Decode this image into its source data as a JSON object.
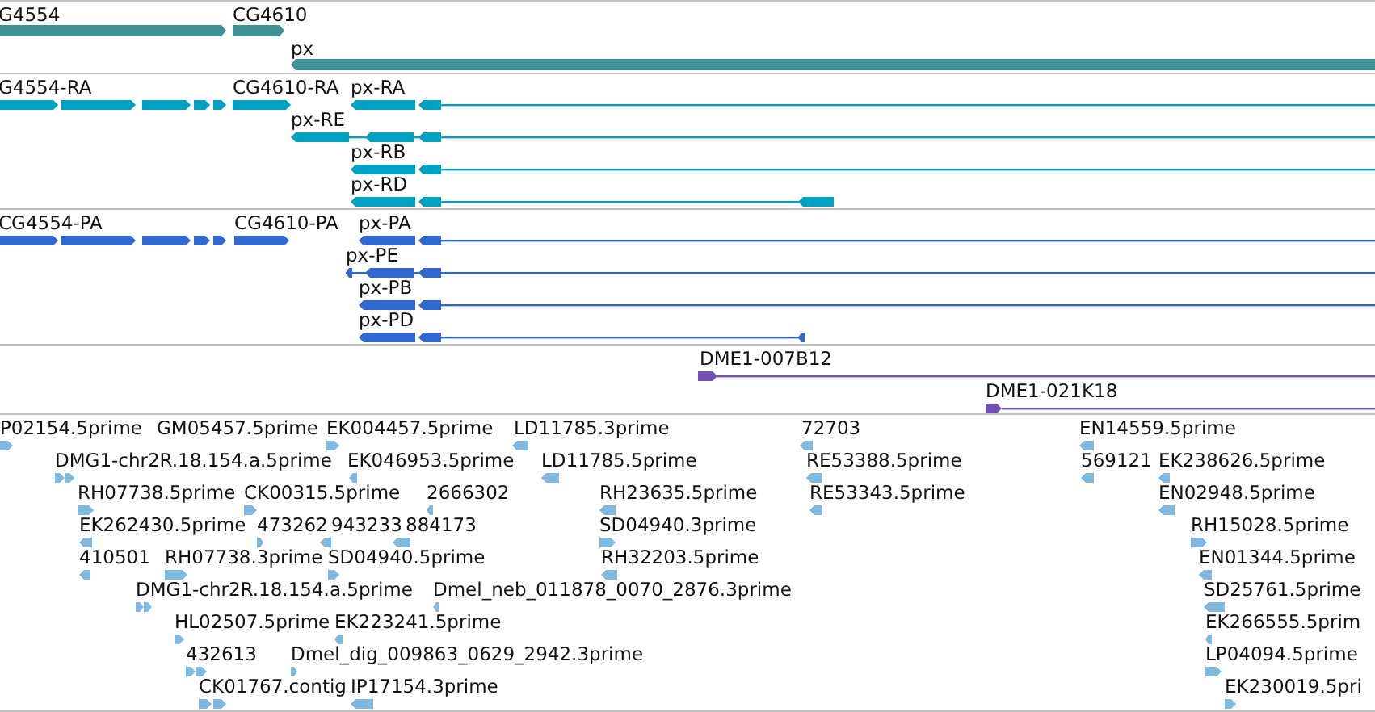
{
  "tracks": [
    {
      "color": "#3f9196",
      "features": [
        {
          "label": "G4554",
          "reverse": false
        },
        {
          "label": "CG4610",
          "reverse": false
        },
        {
          "label": "px",
          "reverse": true
        }
      ]
    },
    {
      "color": "#00a0c0",
      "features": [
        {
          "label": "G4554-RA",
          "reverse": false
        },
        {
          "label": "CG4610-RA",
          "reverse": false
        },
        {
          "label": "px-RA",
          "reverse": true
        },
        {
          "label": "px-RE",
          "reverse": true
        },
        {
          "label": "px-RB",
          "reverse": true
        },
        {
          "label": "px-RD",
          "reverse": true
        }
      ]
    },
    {
      "color": "#3068d0",
      "features": [
        {
          "label": "CG4554-PA",
          "reverse": false
        },
        {
          "label": "CG4610-PA",
          "reverse": false
        },
        {
          "label": "px-PA",
          "reverse": true
        },
        {
          "label": "px-PE",
          "reverse": true
        },
        {
          "label": "px-PB",
          "reverse": true
        },
        {
          "label": "px-PD",
          "reverse": true
        }
      ]
    },
    {
      "color": "#7050b0",
      "features": [
        {
          "label": "DME1-007B12",
          "reverse": false
        },
        {
          "label": "DME1-021K18",
          "reverse": false
        }
      ]
    },
    {
      "color": "#80b8e0",
      "features": [
        {
          "label": "P02154.5prime",
          "reverse": false
        },
        {
          "label": "GM05457.5prime"
        },
        {
          "label": "EK004457.5prime",
          "reverse": false
        },
        {
          "label": "LD11785.3prime",
          "reverse": true
        },
        {
          "label": "72703",
          "reverse": true
        },
        {
          "label": "EN14559.5prime",
          "reverse": true
        },
        {
          "label": "DMG1-chr2R.18.154.a.5prime",
          "reverse": false
        },
        {
          "label": "EK046953.5prime",
          "reverse": true
        },
        {
          "label": "LD11785.5prime",
          "reverse": true
        },
        {
          "label": "RE53388.5prime",
          "reverse": true
        },
        {
          "label": "569121",
          "reverse": true
        },
        {
          "label": "EK238626.5prime",
          "reverse": true
        },
        {
          "label": "RH07738.5prime",
          "reverse": false
        },
        {
          "label": "CK00315.5prime",
          "reverse": false
        },
        {
          "label": "2666302",
          "reverse": true
        },
        {
          "label": "RH23635.5prime",
          "reverse": true
        },
        {
          "label": "RE53343.5prime",
          "reverse": true
        },
        {
          "label": "EN02948.5prime",
          "reverse": true
        },
        {
          "label": "EK262430.5prime",
          "reverse": true
        },
        {
          "label": "473262",
          "reverse": false
        },
        {
          "label": "943233",
          "reverse": true
        },
        {
          "label": "884173",
          "reverse": true
        },
        {
          "label": "SD04940.3prime",
          "reverse": false
        },
        {
          "label": "RH15028.5prime",
          "reverse": false
        },
        {
          "label": "410501",
          "reverse": true
        },
        {
          "label": "RH07738.3prime",
          "reverse": false
        },
        {
          "label": "SD04940.5prime",
          "reverse": false
        },
        {
          "label": "RH32203.5prime",
          "reverse": true
        },
        {
          "label": "EN01344.5prime",
          "reverse": true
        },
        {
          "label": "DMG1-chr2R.18.154.a.5prime",
          "reverse": false
        },
        {
          "label": "Dmel_neb_011878_0070_2876.3prime",
          "reverse": true
        },
        {
          "label": "SD25761.5prime",
          "reverse": true
        },
        {
          "label": "HL02507.5prime",
          "reverse": false
        },
        {
          "label": "EK223241.5prime",
          "reverse": true
        },
        {
          "label": "EK266555.5prim",
          "reverse": true
        },
        {
          "label": "432613",
          "reverse": false
        },
        {
          "label": "Dmel_dig_009863_0629_2942.3prime",
          "reverse": false
        },
        {
          "label": "LP04094.5prime",
          "reverse": false
        },
        {
          "label": "CK01767.contig",
          "reverse": false
        },
        {
          "label": "IP17154.3prime",
          "reverse": true
        },
        {
          "label": "EK230019.5pri",
          "reverse": false
        }
      ]
    }
  ]
}
